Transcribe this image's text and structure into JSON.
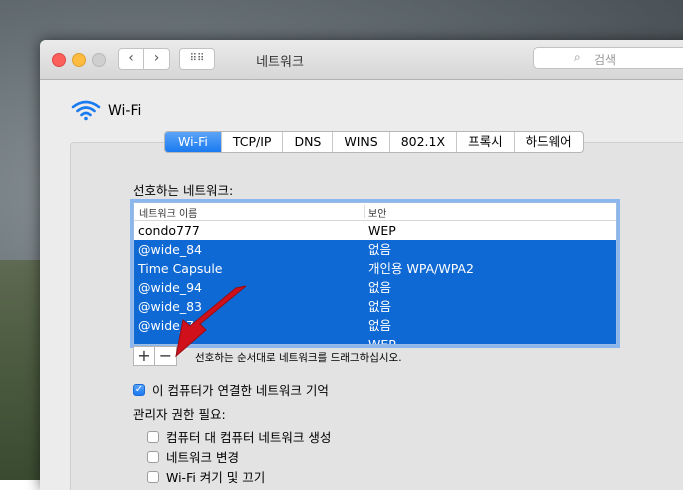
{
  "window": {
    "title": "네트워크",
    "nav_back": "‹",
    "nav_forward": "›",
    "grid_icon": "⠿⠿"
  },
  "search": {
    "placeholder": "검색",
    "icon": "search-icon"
  },
  "header": {
    "service_name": "Wi-Fi",
    "icon": "wifi-icon"
  },
  "tabs": [
    {
      "label": "Wi-Fi",
      "active": true
    },
    {
      "label": "TCP/IP"
    },
    {
      "label": "DNS"
    },
    {
      "label": "WINS"
    },
    {
      "label": "802.1X"
    },
    {
      "label": "프록시"
    },
    {
      "label": "하드웨어"
    }
  ],
  "preferred": {
    "label": "선호하는 네트워크:",
    "columns": [
      "네트워크 이름",
      "보안"
    ],
    "rows": [
      {
        "name": "condo777",
        "security": "WEP",
        "selected": false
      },
      {
        "name": "@wide_84",
        "security": "없음",
        "selected": true
      },
      {
        "name": "Time Capsule",
        "security": "개인용 WPA/WPA2",
        "selected": true
      },
      {
        "name": "@wide_94",
        "security": "없음",
        "selected": true
      },
      {
        "name": "@wide_83",
        "security": "없음",
        "selected": true
      },
      {
        "name": "@wide_7",
        "security": "없음",
        "selected": true
      },
      {
        "name": "",
        "security": "WEP",
        "selected": true
      }
    ],
    "add_label": "+",
    "remove_label": "−",
    "hint": "선호하는 순서대로 네트워크를 드래그하십시오."
  },
  "remember": {
    "label": "이 컴퓨터가 연결한 네트워크 기억",
    "checked": true
  },
  "admin": {
    "label": "관리자 권한 필요:",
    "options": [
      {
        "label": "컴퓨터 대 컴퓨터 네트워크 생성",
        "checked": false
      },
      {
        "label": "네트워크 변경",
        "checked": false
      },
      {
        "label": "Wi-Fi 켜기 및 끄기",
        "checked": false
      }
    ]
  },
  "colors": {
    "accent": "#1a7af0",
    "selection": "#0e69d4",
    "arrow": "#d0101a"
  }
}
